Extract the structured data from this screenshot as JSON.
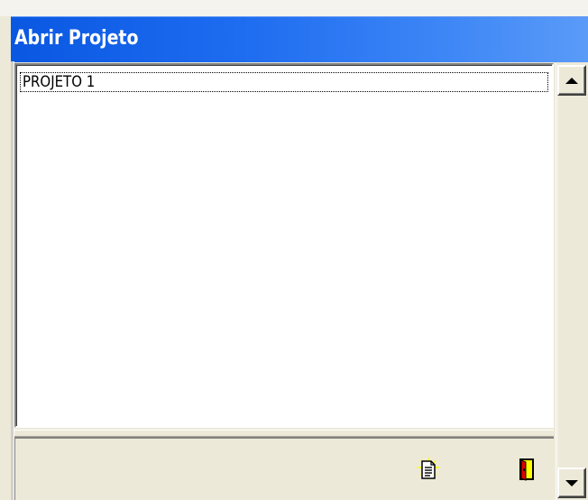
{
  "window": {
    "title": "Abrir Projeto"
  },
  "project_list": {
    "items": [
      {
        "label": "PROJETO 1"
      }
    ]
  },
  "toolbar": {
    "new_project_icon": "new-document-icon",
    "exit_icon": "exit-door-icon"
  },
  "colors": {
    "titlebar_start": "#0a58e2",
    "titlebar_end": "#5a9bf8",
    "window_bg": "#ece9d8",
    "list_bg": "#ffffff"
  }
}
